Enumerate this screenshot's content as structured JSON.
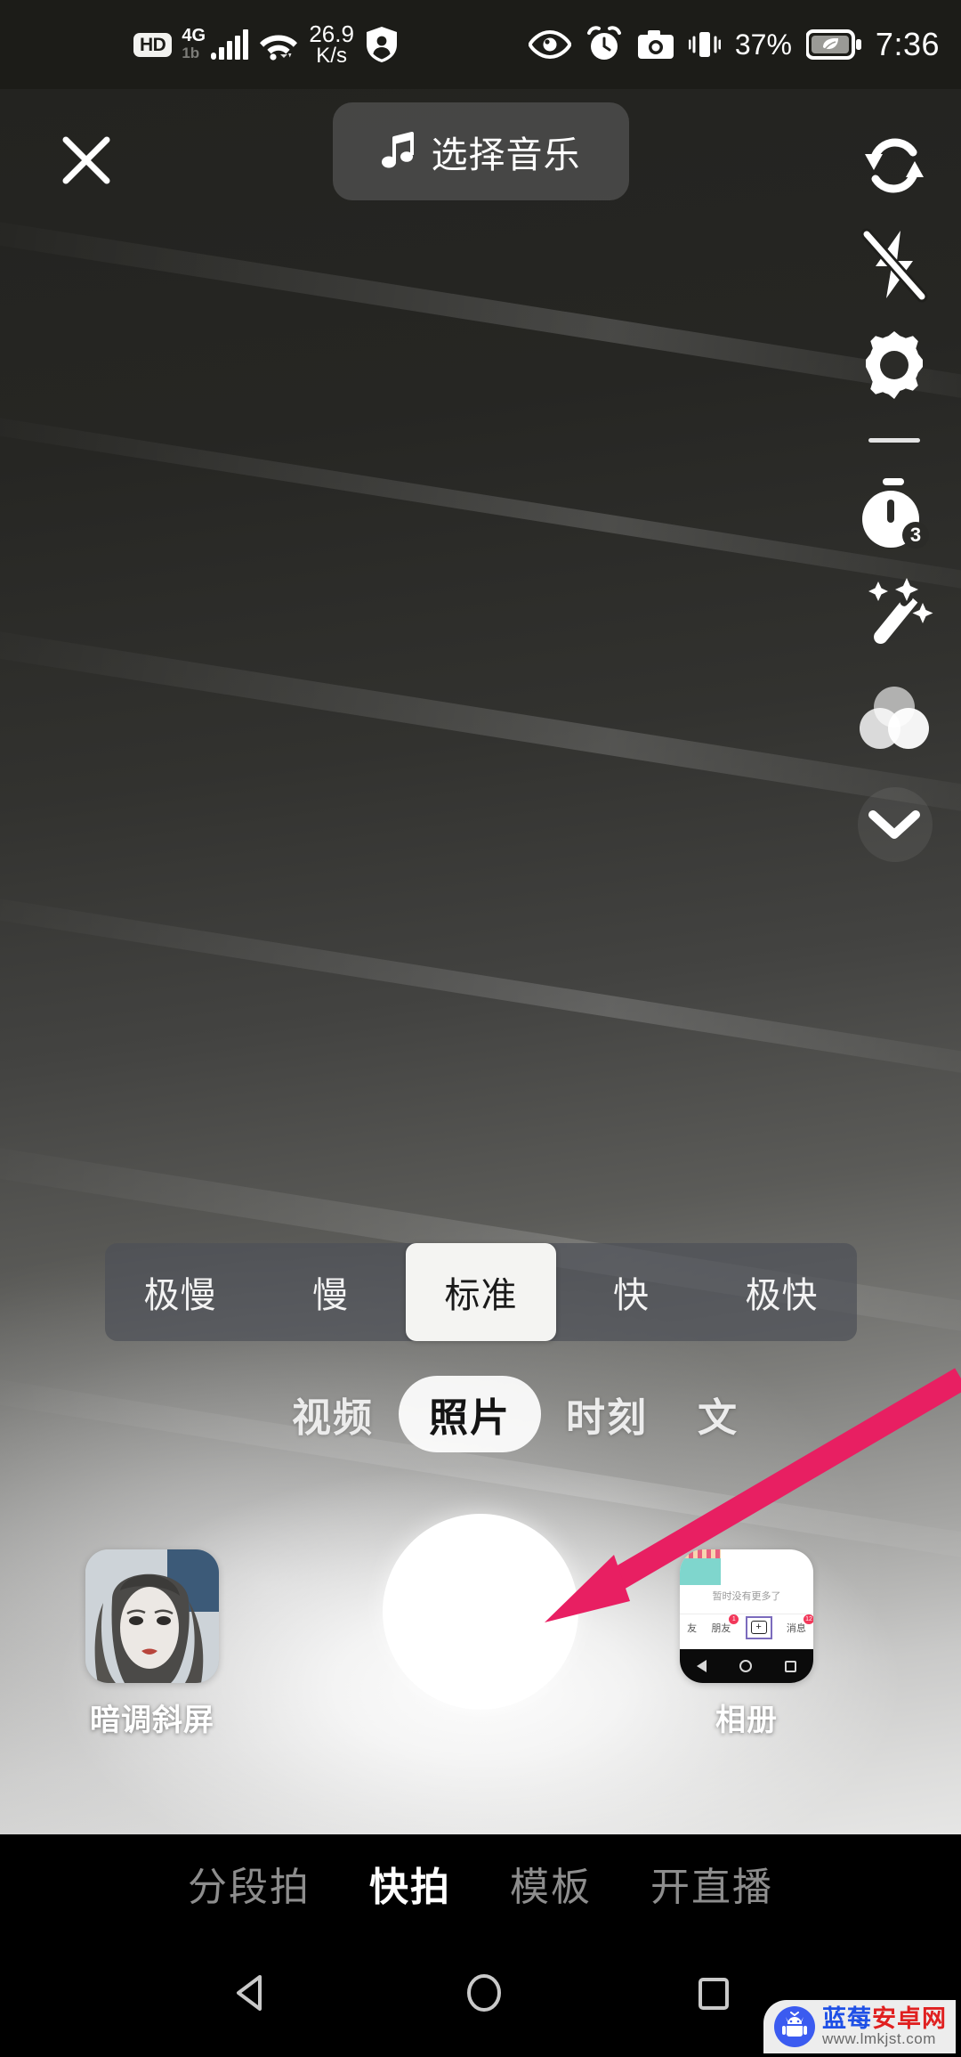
{
  "status_bar": {
    "hd_badge": "HD",
    "network_type": "4G",
    "network_sub": "1b",
    "data_speed_value": "26.9",
    "data_speed_unit": "K/s",
    "battery_percent": "37%",
    "time": "7:36",
    "icons": [
      "hd-badge",
      "signal-bars-icon",
      "wifi-icon",
      "data-speed-icon",
      "shield-person-icon",
      "eye-icon",
      "alarm-clock-icon",
      "camera-icon",
      "vibrate-icon",
      "battery-eco-icon"
    ]
  },
  "top_bar": {
    "close_label": "✕",
    "close_icon": "close-icon",
    "music_button_label": "选择音乐",
    "music_icon": "music-note-icon"
  },
  "tool_rail": {
    "items": [
      {
        "name": "flip-camera-icon",
        "label": "翻转"
      },
      {
        "name": "flash-off-icon",
        "label": "闪光灯关"
      },
      {
        "name": "gear-icon",
        "label": "设置"
      },
      {
        "name": "divider",
        "label": ""
      },
      {
        "name": "timer-icon",
        "label": "倒计时",
        "badge": "3"
      },
      {
        "name": "magic-wand-icon",
        "label": "美化"
      },
      {
        "name": "filter-circles-icon",
        "label": "滤镜"
      },
      {
        "name": "chevron-down-icon",
        "label": "收起"
      }
    ]
  },
  "speed_selector": {
    "options": [
      "极慢",
      "慢",
      "标准",
      "快",
      "极快"
    ],
    "selected_index": 2
  },
  "mode_tabs": {
    "items": [
      "视频",
      "照片",
      "时刻",
      "文"
    ],
    "selected_index": 1
  },
  "capture_row": {
    "effect": {
      "label": "暗调斜屏",
      "thumb_name": "effect-preview-thumbnail"
    },
    "shutter": {
      "name": "shutter-button"
    },
    "album": {
      "label": "相册",
      "thumb_name": "album-preview-thumbnail",
      "thumb_content": {
        "empty_text": "暂时没有更多了",
        "nav_left": "友",
        "nav_friends": "朋友",
        "nav_friends_badge": "1",
        "nav_messages": "消息",
        "nav_messages_badge": "12",
        "plus_label": "+"
      }
    }
  },
  "bottom_nav": {
    "items": [
      "分段拍",
      "快拍",
      "模板",
      "开直播"
    ],
    "selected_index": 1
  },
  "android_nav": {
    "back": "back-triangle-icon",
    "home": "home-circle-icon",
    "recents": "recents-square-icon"
  },
  "annotation": {
    "arrow_name": "pink-pointer-arrow",
    "arrow_color": "#E81F62",
    "points_to": "shutter-button"
  },
  "watermark": {
    "cn_prefix": "蓝莓",
    "cn_suffix": "安卓网",
    "url": "www.lmkjst.com",
    "logo_name": "android-robot-logo"
  },
  "colors": {
    "accent_pink": "#E81F62",
    "status_bg": "#1C1C18",
    "nav_bg": "#000000",
    "speed_bar_bg": "rgba(78,80,88,.72)",
    "active_pill": "#F4F4F2"
  }
}
